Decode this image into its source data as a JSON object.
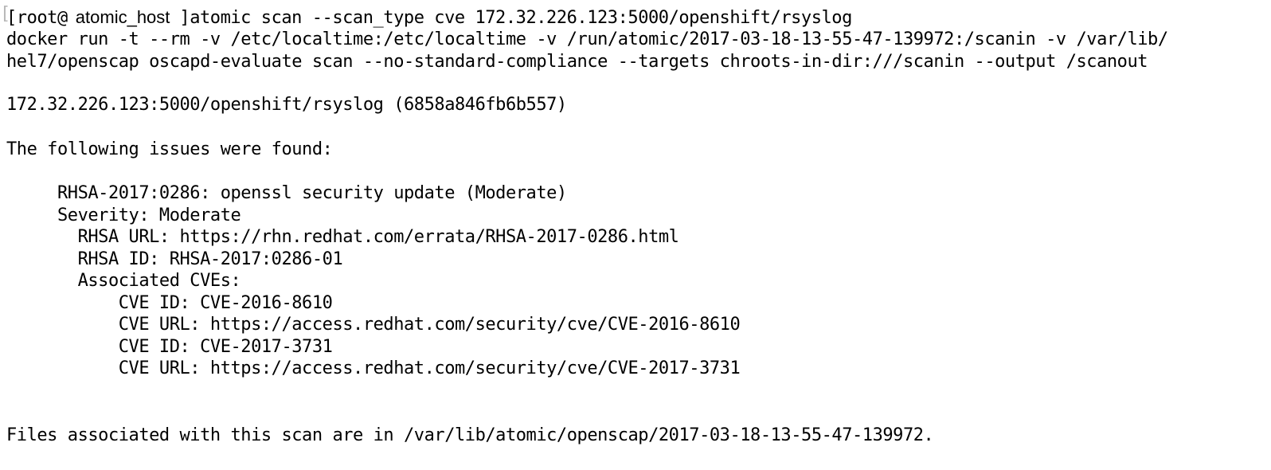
{
  "terminal": {
    "prompt_user": "[root@",
    "hostname": "atomic_host",
    "prompt_close": "]",
    "command": "atomic scan --scan_type cve 172.32.226.123:5000/openshift/rsyslog",
    "lines": [
      "docker run -t --rm -v /etc/localtime:/etc/localtime -v /run/atomic/2017-03-18-13-55-47-139972:/scanin -v /var/lib/",
      "hel7/openscap oscapd-evaluate scan --no-standard-compliance --targets chroots-in-dir:///scanin --output /scanout",
      "172.32.226.123:5000/openshift/rsyslog (6858a846fb6b557)",
      "The following issues were found:",
      "     RHSA-2017:0286: openssl security update (Moderate)",
      "     Severity: Moderate",
      "       RHSA URL: https://rhn.redhat.com/errata/RHSA-2017-0286.html",
      "       RHSA ID: RHSA-2017:0286-01",
      "       Associated CVEs:",
      "           CVE ID: CVE-2016-8610",
      "           CVE URL: https://access.redhat.com/security/cve/CVE-2016-8610",
      "           CVE ID: CVE-2017-3731",
      "           CVE URL: https://access.redhat.com/security/cve/CVE-2017-3731",
      "Files associated with this scan are in /var/lib/atomic/openscap/2017-03-18-13-55-47-139972."
    ]
  }
}
